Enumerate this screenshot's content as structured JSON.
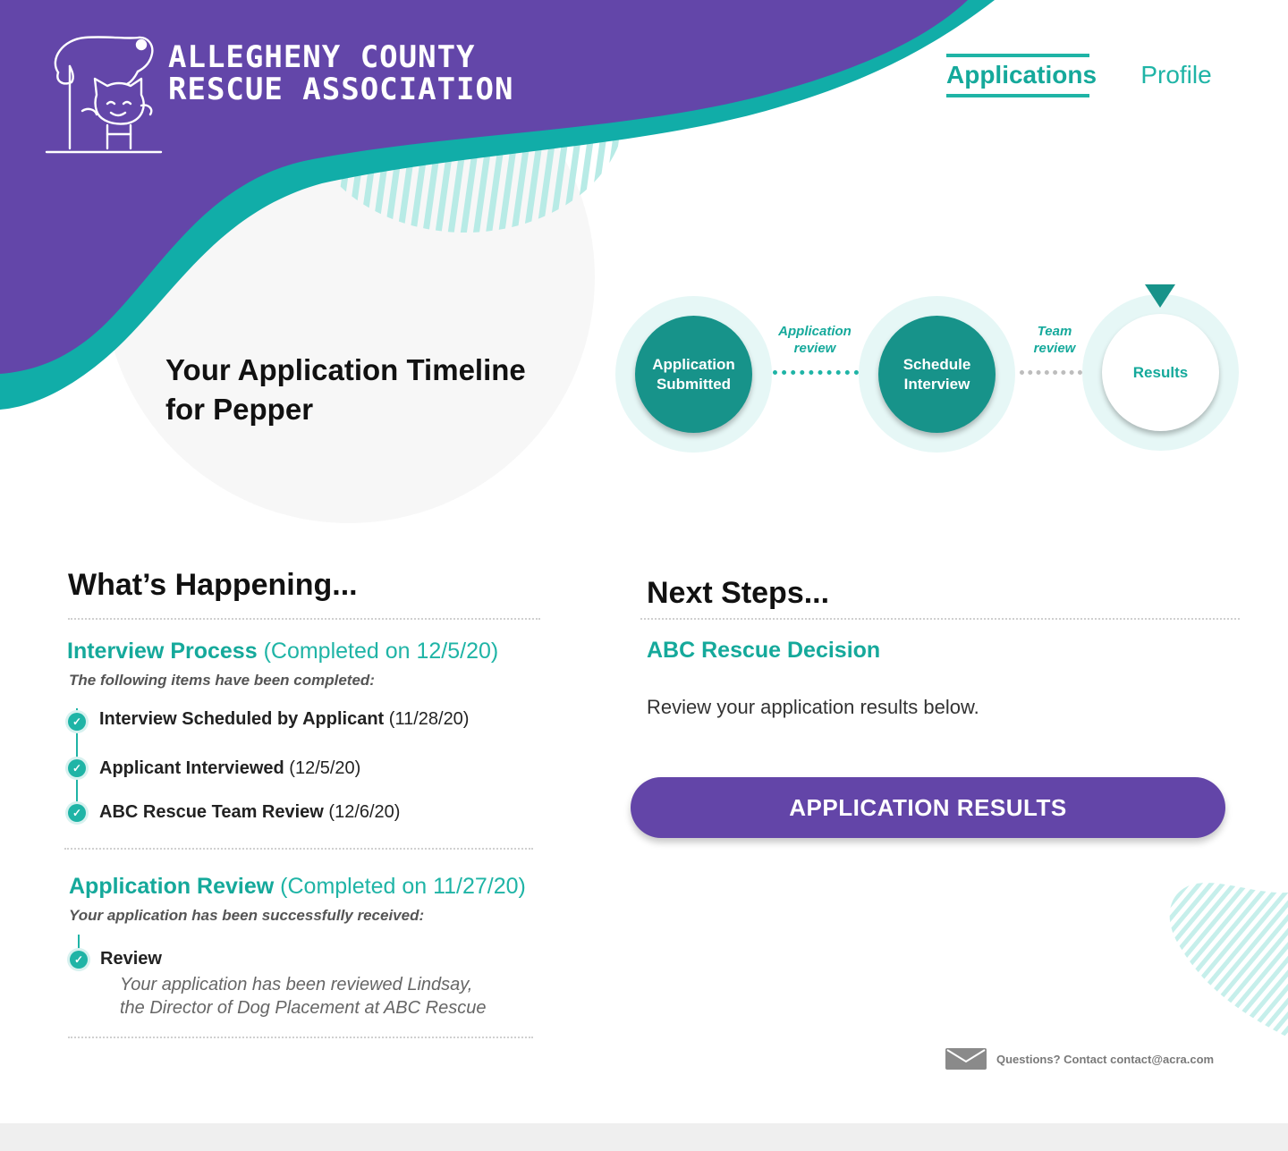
{
  "brand": {
    "line1": "ALLEGHENY COUNTY",
    "line2": "RESCUE ASSOCIATION",
    "logo_icon": "dog-and-cat-logo-icon"
  },
  "nav": {
    "applications": "Applications",
    "profile": "Profile",
    "active": "Applications"
  },
  "colors": {
    "purple": "#6345a8",
    "teal": "#15a99b",
    "teal_dark": "#17938a",
    "pale_teal": "#e6f7f6"
  },
  "timeline": {
    "title_line1": "Your Application Timeline",
    "title_line2": "for Pepper",
    "steps": [
      {
        "line1": "Application",
        "line2": "Submitted",
        "status": "done"
      },
      {
        "line1": "Schedule",
        "line2": "Interview",
        "status": "done"
      },
      {
        "line1": "Results",
        "line2": "",
        "status": "current"
      }
    ],
    "connectors": [
      {
        "line1": "Application",
        "line2": "review",
        "status": "done"
      },
      {
        "line1": "Team",
        "line2": "review",
        "status": "pending"
      }
    ]
  },
  "happening": {
    "title": "What’s Happening...",
    "groups": [
      {
        "title": "Interview Process",
        "completed": "(Completed on 12/5/20)",
        "note": "The following items have been completed:",
        "items": [
          {
            "label": "Interview Scheduled by Applicant",
            "date": "(11/28/20)"
          },
          {
            "label": "Applicant Interviewed",
            "date": "(12/5/20)"
          },
          {
            "label": "ABC Rescue Team Review",
            "date": "(12/6/20)"
          }
        ]
      },
      {
        "title": "Application Review",
        "completed": "(Completed on 11/27/20)",
        "note": "Your application has been successfully received:",
        "items": [
          {
            "label": "Review",
            "desc_line1": "Your application has been reviewed Lindsay,",
            "desc_line2": "the Director of Dog Placement at ABC Rescue"
          }
        ]
      }
    ]
  },
  "next_steps": {
    "title": "Next Steps...",
    "heading": "ABC Rescue Decision",
    "text": "Review your application results below.",
    "button": "APPLICATION RESULTS"
  },
  "contact": {
    "icon": "envelope-icon",
    "text": "Questions? Contact contact@acra.com"
  }
}
